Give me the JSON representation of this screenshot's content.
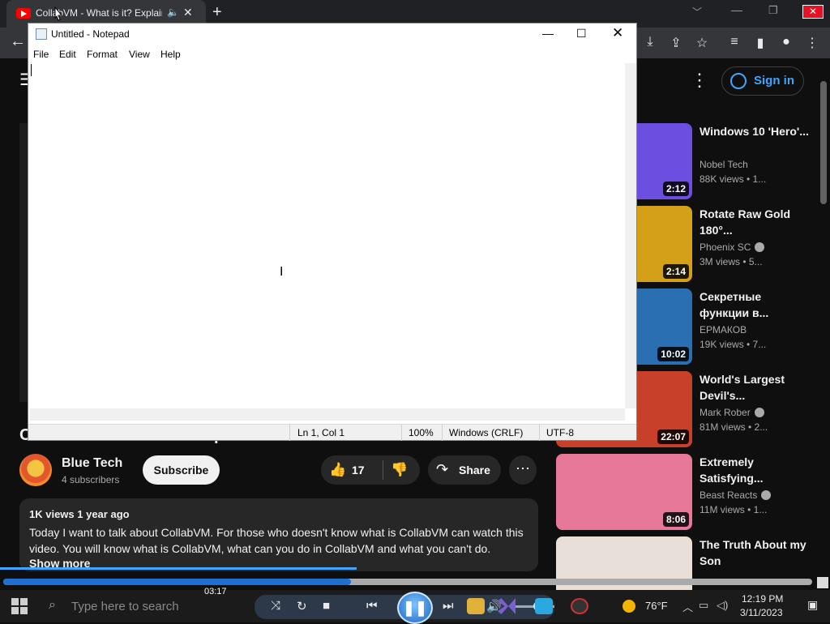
{
  "browser": {
    "tab_title": "CollabVM - What is it? Explained",
    "tab_audio_icon": "speaker-icon",
    "close_glyph": "✕",
    "newtab_glyph": "+",
    "min_glyph": "—",
    "restore_glyph": "❐",
    "back_glyph": "←"
  },
  "youtube": {
    "signin_label": "Sign in",
    "video_title": "CollabVM - What is it? Explained",
    "channel_name": "Blue Tech",
    "subscribers": "4 subscribers",
    "subscribe_label": "Subscribe",
    "like_count": "17",
    "share_label": "Share",
    "views_meta": "1K views  1 year ago",
    "description": "Today I want to talk about CollabVM. For those who doesn't know what is CollabVM can watch this video. You will know what is CollabVM, what can you do in CollabVM and what you can't do.",
    "show_more": "Show more",
    "recommendations": [
      {
        "title": "Windows 10 'Hero'...",
        "channel": "Nobel Tech",
        "views": "88K views • 1...",
        "duration": "2:12",
        "verified": false,
        "thumb_color": "#6c4ee0"
      },
      {
        "title": "Rotate Raw Gold 180°...",
        "channel": "Phoenix SC",
        "views": "3M views • 5...",
        "duration": "2:14",
        "verified": true,
        "thumb_color": "#d4a017"
      },
      {
        "title": "Секретные функции в...",
        "channel": "ЕРМАКОВ",
        "views": "19K views • 7...",
        "duration": "10:02",
        "verified": false,
        "thumb_color": "#2b6fb3"
      },
      {
        "title": "World's Largest Devil's...",
        "channel": "Mark Rober",
        "views": "81M views • 2...",
        "duration": "22:07",
        "verified": true,
        "thumb_color": "#c8402a"
      },
      {
        "title": "Extremely Satisfying...",
        "channel": "Beast Reacts",
        "views": "11M views • 1...",
        "duration": "8:06",
        "verified": true,
        "thumb_color": "#e8789a"
      },
      {
        "title": "The Truth About my Son",
        "channel": "",
        "views": "",
        "duration": "",
        "verified": false,
        "thumb_color": "#e8e0d8"
      }
    ]
  },
  "notepad": {
    "title": "Untitled - Notepad",
    "menu": [
      "File",
      "Edit",
      "Format",
      "View",
      "Help"
    ],
    "status": {
      "position": "Ln 1, Col 1",
      "zoom": "100%",
      "line_endings": "Windows (CRLF)",
      "encoding": "UTF-8"
    }
  },
  "media": {
    "time": "03:17",
    "seek_progress": 0.43,
    "volume_level": 0.5
  },
  "taskbar": {
    "search_placeholder": "Type here to search",
    "temperature": "76°F",
    "time": "12:19 PM",
    "date": "3/11/2023"
  },
  "colors": {
    "youtube_red": "#ff0000",
    "link_blue": "#3ea6ff",
    "close_red": "#e81123"
  }
}
